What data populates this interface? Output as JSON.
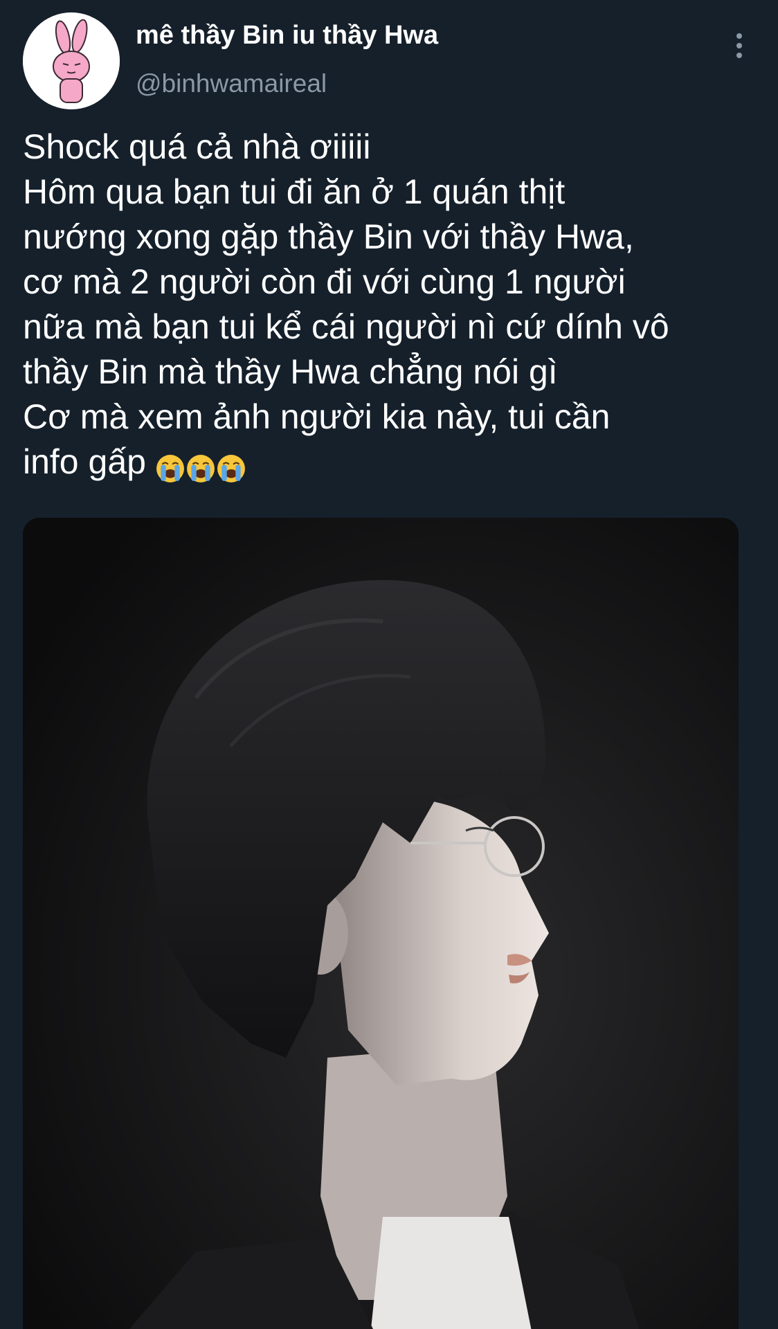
{
  "author": {
    "display_name": "mê thầy Bin iu thầy Hwa",
    "handle": "@binhwamaireal",
    "avatar_icon": "pink-bunny-avatar"
  },
  "more_icon": "more-vertical-icon",
  "tweet": {
    "lines": [
      "Shock quá cả nhà ơiiiii",
      "Hôm qua bạn tui đi ăn ở 1 quán thịt",
      "nướng xong gặp thầy Bin với thầy Hwa,",
      "cơ mà 2 người còn đi với cùng 1 người",
      "nữa mà bạn tui kể cái người nì cứ dính vô",
      "thầy Bin mà thầy Hwa chẳng nói gì",
      "Cơ mà xem ảnh người kia này, tui cần",
      "info gấp"
    ],
    "emoji": "loudly-crying-face-emoji"
  },
  "media": {
    "kind": "photo",
    "icon": "profile-portrait-photo"
  },
  "colors": {
    "background": "#15202b",
    "text": "#ffffff",
    "muted": "#8b98a5"
  }
}
